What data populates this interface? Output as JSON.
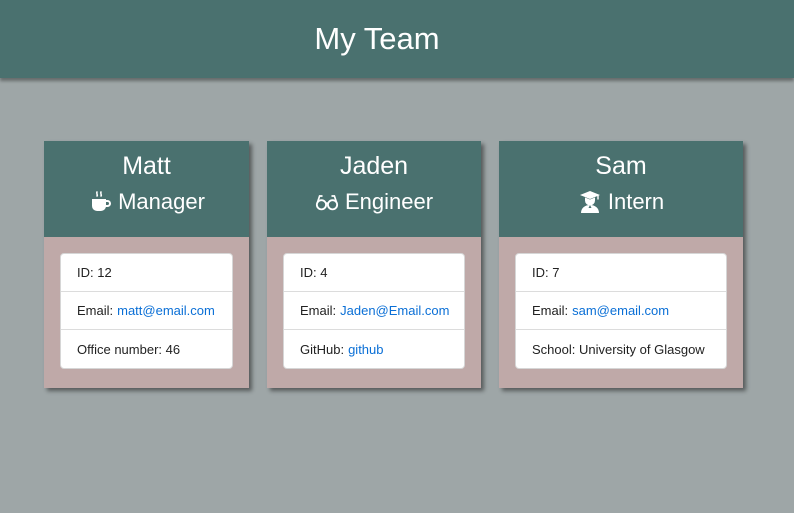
{
  "header": {
    "title": "My Team"
  },
  "cards": [
    {
      "name": "Matt",
      "role": "Manager",
      "icon": "coffee-mug-icon",
      "id_label": "ID: 12",
      "email_label": "Email:",
      "email": "matt@email.com",
      "extra_label": "Office number: 46",
      "extra_link": ""
    },
    {
      "name": "Jaden",
      "role": "Engineer",
      "icon": "glasses-icon",
      "id_label": "ID: 4",
      "email_label": "Email:",
      "email": "Jaden@Email.com",
      "extra_label": "GitHub:",
      "extra_link": "github"
    },
    {
      "name": "Sam",
      "role": "Intern",
      "icon": "graduate-icon",
      "id_label": "ID: 7",
      "email_label": "Email:",
      "email": "sam@email.com",
      "extra_label": "School: University of Glasgow",
      "extra_link": ""
    }
  ],
  "colors": {
    "header_bg": "#4a716f",
    "page_bg": "#9ea6a7",
    "card_body_bg": "#bfa9a8",
    "link": "#0a6fd6"
  }
}
